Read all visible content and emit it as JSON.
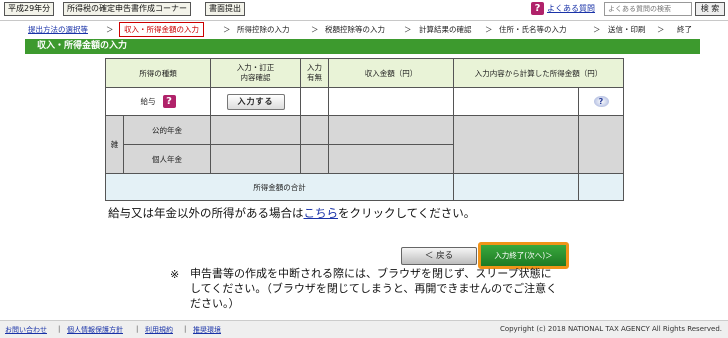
{
  "topbar": {
    "year": "平成29年分",
    "corner": "所得税の確定申告書作成コーナー",
    "submission": "書面提出",
    "faq_link": "よくある質問",
    "search_placeholder": "よくある質問の検索",
    "search_button": "検 索"
  },
  "steps": {
    "items": [
      {
        "label": "提出方法の選択等"
      },
      {
        "label": "収入・所得金額の入力"
      },
      {
        "label": "所得控除の入力"
      },
      {
        "label": "税額控除等の入力"
      },
      {
        "label": "計算結果の確認"
      },
      {
        "label": "住所・氏名等の入力"
      },
      {
        "label": "送信・印刷"
      },
      {
        "label": "終了"
      }
    ],
    "separator": "＞"
  },
  "section": {
    "title": "収入・所得金額の入力"
  },
  "table": {
    "headers": {
      "type": "所得の種類",
      "confirm": "入力・訂正\n内容確認",
      "presence": "入力\n有無",
      "income": "収入金額（円）",
      "computed": "入力内容から計算した所得金額（円）"
    },
    "rows": {
      "salary_label": "給与",
      "input_button": "入力する",
      "misc_label": "雑",
      "public_pension": "公的年金",
      "private_pension": "個人年金",
      "total_label": "所得金額の合計"
    },
    "help_icon_text": "?"
  },
  "body": {
    "text_before": "給与又は年金以外の所得がある場合は",
    "link": "こちら",
    "text_after": "をクリックしてください。"
  },
  "buttons": {
    "back": "＜ 戻る",
    "next": "入力終了(次へ)＞"
  },
  "note": {
    "mark": "※",
    "text": "申告書等の作成を中断される際には、ブラウザを閉じず、スリープ状態にしてください。（ブラウザを閉じてしまうと、再開できませんのでご注意ください。）"
  },
  "footer": {
    "links": [
      "お問い合わせ",
      "個人情報保護方針",
      "利用規約",
      "推奨環境"
    ],
    "copyright": "Copyright (c) 2018 NATIONAL TAX AGENCY All Rights Reserved."
  },
  "colors": {
    "section_header": "#3d9a2e",
    "next_button": "#1e7a24",
    "next_highlight": "#f09419",
    "link": "#1a33a8",
    "current_step": "#cc0000"
  }
}
